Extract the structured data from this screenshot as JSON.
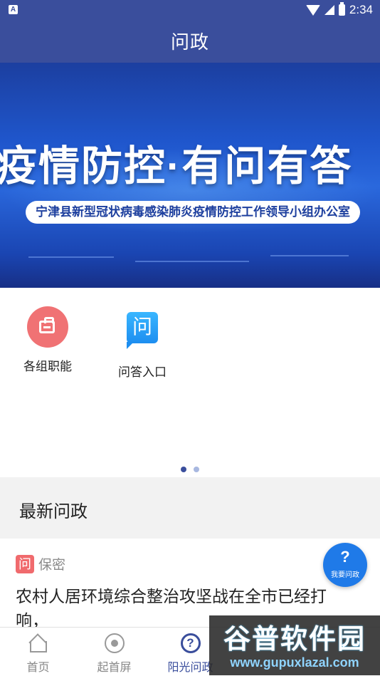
{
  "status_bar": {
    "time": "2:34",
    "app_badge": "A"
  },
  "header": {
    "title": "问政"
  },
  "banner": {
    "headline": "疫情防控·有问有答",
    "subtitle": "宁津县新型冠状病毒感染肺炎疫情防控工作领导小组办公室"
  },
  "quick_links": [
    {
      "label": "各组职能",
      "icon": "briefcase-icon"
    },
    {
      "label": "问答入口",
      "icon": "question-bubble-icon",
      "glyph": "问"
    }
  ],
  "pager": {
    "pages": 2,
    "current": 1
  },
  "latest": {
    "section_title": "最新问政",
    "posts": [
      {
        "tag_icon": "问",
        "tag": "保密",
        "text": "农村人居环境综合整治攻坚战在全市已经打响，"
      }
    ]
  },
  "fab": {
    "icon": "?",
    "label": "我要问政"
  },
  "tabs": [
    {
      "label": "首页",
      "icon": "home-icon"
    },
    {
      "label": "起首屏",
      "icon": "atom-icon"
    },
    {
      "label": "阳光问政",
      "icon": "question-circle-icon",
      "glyph": "?"
    }
  ],
  "watermark": {
    "text": "谷普软件园",
    "url": "www.gupuxlazal.com"
  },
  "colors": {
    "primary": "#3a4e9c",
    "accent_red": "#f07274",
    "accent_blue": "#1f7ae8"
  }
}
